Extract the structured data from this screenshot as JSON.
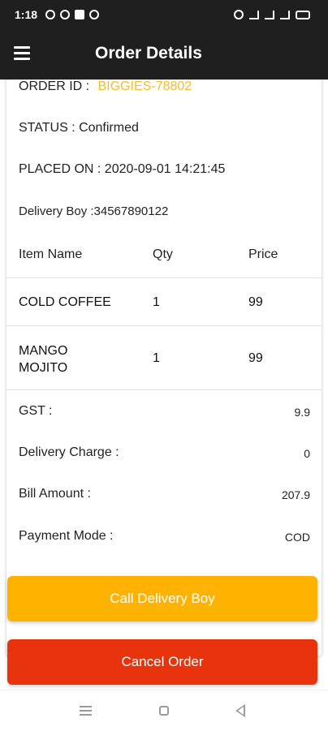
{
  "status_bar": {
    "time": "1:18"
  },
  "app_bar": {
    "title": "Order Details"
  },
  "order": {
    "id_label": "ORDER ID :",
    "id_value": "BIGGIES-78802",
    "status": "STATUS : Confirmed",
    "placed_on": "PLACED ON : 2020-09-01 14:21:45",
    "delivery_boy": "Delivery Boy :34567890122"
  },
  "items_table": {
    "headers": [
      "Item Name",
      "Qty",
      "Price"
    ],
    "rows": [
      {
        "name": "COLD COFFEE",
        "qty": "1",
        "price": "99"
      },
      {
        "name": "MANGO MOJITO",
        "qty": "1",
        "price": "99"
      }
    ]
  },
  "summary": [
    {
      "label": "GST :",
      "value": "9.9"
    },
    {
      "label": "Delivery Charge :",
      "value": "0"
    },
    {
      "label": "Bill Amount :",
      "value": "207.9"
    },
    {
      "label": "Payment Mode :",
      "value": "COD"
    }
  ],
  "buttons": {
    "call_delivery_boy": "Call Delivery Boy",
    "cancel_order": "Cancel Order"
  },
  "colors": {
    "accent": "#f5bd2a",
    "call_button": "#ffb300",
    "cancel_button": "#e8340c",
    "app_bar": "#1f1f1f"
  }
}
